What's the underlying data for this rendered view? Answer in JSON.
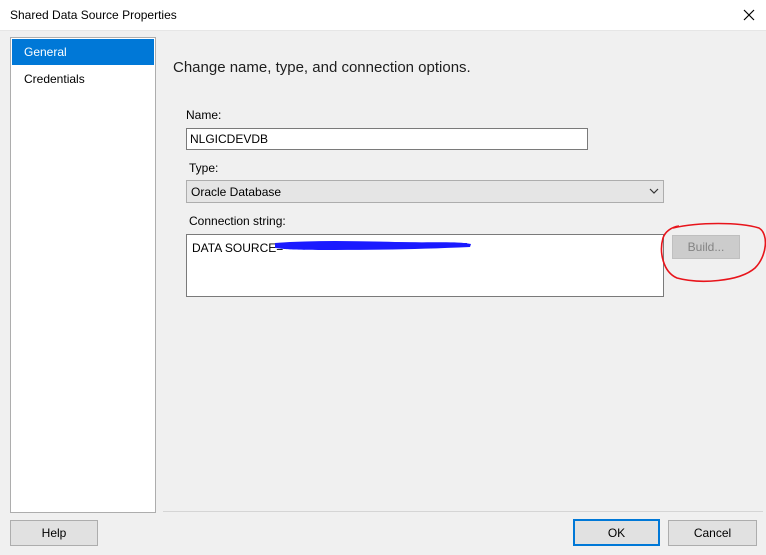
{
  "window": {
    "title": "Shared Data Source Properties"
  },
  "nav": {
    "items": [
      {
        "label": "General",
        "selected": true
      },
      {
        "label": "Credentials",
        "selected": false
      }
    ]
  },
  "general": {
    "heading": "Change name, type, and connection options.",
    "name_label": "Name:",
    "name_value": "NLGICDEVDB",
    "type_label": "Type:",
    "type_value": "Oracle Database",
    "conn_label": "Connection string:",
    "conn_value": "DATA SOURCE=",
    "build_label": "Build..."
  },
  "footer": {
    "help_label": "Help",
    "ok_label": "OK",
    "cancel_label": "Cancel"
  },
  "colors": {
    "selection": "#0078d7",
    "redaction": "#1a1aff",
    "annotation": "#e8141b"
  }
}
